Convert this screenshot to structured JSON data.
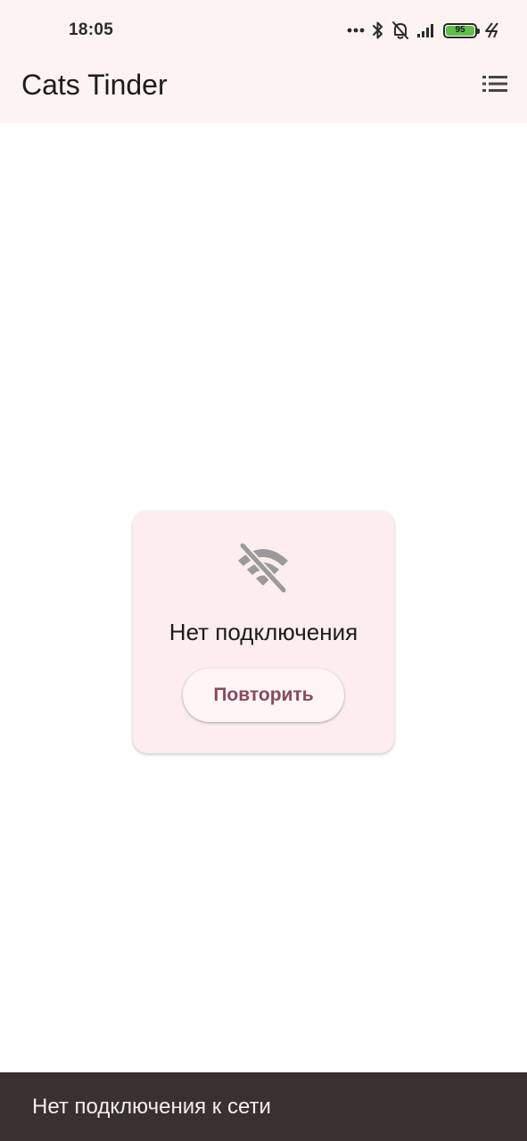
{
  "status_bar": {
    "time": "18:05",
    "battery_level": "95",
    "icons": [
      "more-dots-icon",
      "bluetooth-icon",
      "bell-off-icon",
      "signal-icon",
      "battery-icon",
      "charging-icon"
    ]
  },
  "app_bar": {
    "title": "Cats Tinder",
    "menu_icon": "list-icon"
  },
  "error_card": {
    "icon": "wifi-off-icon",
    "message": "Нет подключения",
    "retry_label": "Повторить"
  },
  "snackbar": {
    "message": "Нет подключения к сети"
  },
  "colors": {
    "app_bar_background": "#fdf4f2",
    "card_background": "#fdeeed",
    "button_text": "#8a4a5c",
    "snackbar_background": "#383031",
    "battery_fill": "#5fc04a"
  }
}
